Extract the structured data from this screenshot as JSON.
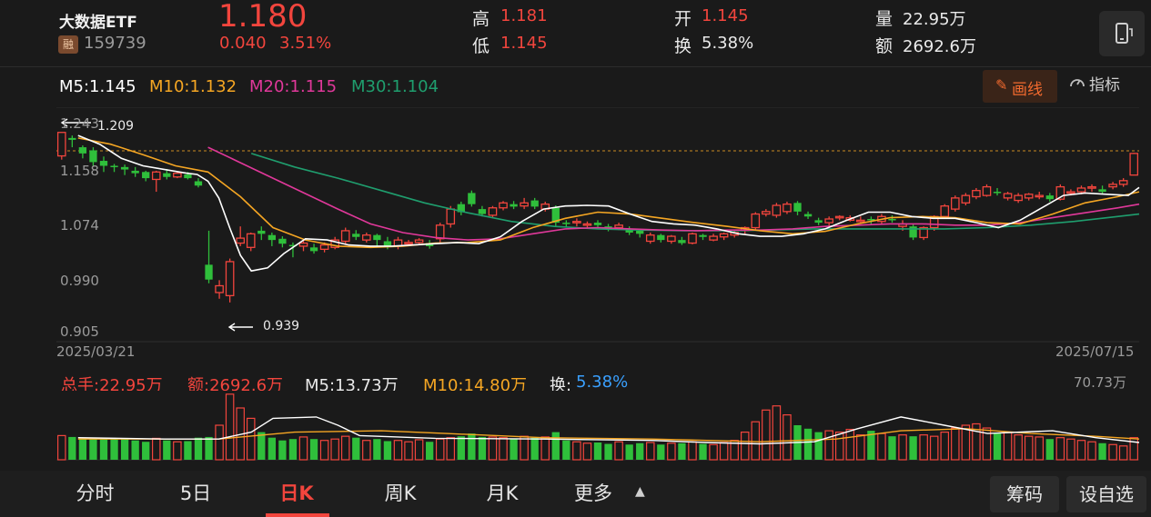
{
  "header": {
    "name": "大数据ETF",
    "badge": "融",
    "code": "159739",
    "price": "1.180",
    "change": "0.040",
    "change_pct": "3.51%",
    "high_label": "高",
    "high_value": "1.181",
    "low_label": "低",
    "low_value": "1.145",
    "open_label": "开",
    "open_value": "1.145",
    "turnover_label": "换",
    "turnover_value": "5.38%",
    "volume_label": "量",
    "volume_value": "22.95万",
    "amount_label": "额",
    "amount_value": "2692.6万"
  },
  "ma_legend": {
    "m5": "M5:1.145",
    "m10": "M10:1.132",
    "m20": "M20:1.115",
    "m30": "M30:1.104"
  },
  "tools": {
    "draw_label": "画线",
    "indicator_label": "指标"
  },
  "colors": {
    "up": "#f2453d",
    "down": "#2fbf3b",
    "m5": "#ffffff",
    "m10": "#f5a623",
    "m20": "#e0389a",
    "m30": "#1f9e6e"
  },
  "price_axis": {
    "ticks": [
      "1.243",
      "1.158",
      "1.074",
      "0.990",
      "0.905"
    ],
    "start_date": "2025/03/21",
    "end_date": "2025/07/15",
    "high_marker": "1.209",
    "low_marker": "0.939"
  },
  "volume_legend": {
    "total": "总手:22.95万",
    "amount": "额:2692.6万",
    "m5": "M5:13.73万",
    "m10": "M10:14.80万",
    "turnover_label": "换:",
    "turnover_value": "5.38%",
    "max": "70.73万"
  },
  "bottom_tabs": [
    "分时",
    "5日",
    "日K",
    "周K",
    "月K",
    "更多"
  ],
  "bottom_buttons": {
    "chips": "筹码",
    "self_select": "设自选"
  },
  "chart_data": {
    "type": "candlestick",
    "title": "",
    "x_start": "2025/03/21",
    "x_end": "2025/07/15",
    "ylim": [
      0.905,
      1.243
    ],
    "candles": [
      [
        1.176,
        1.214,
        1.211,
        1.17
      ],
      [
        1.205,
        1.202,
        1.209,
        1.19
      ],
      [
        1.19,
        1.18,
        1.193,
        1.172
      ],
      [
        1.185,
        1.166,
        1.19,
        1.16
      ],
      [
        1.168,
        1.16,
        1.175,
        1.15
      ],
      [
        1.16,
        1.158,
        1.163,
        1.15
      ],
      [
        1.158,
        1.154,
        1.162,
        1.145
      ],
      [
        1.152,
        1.148,
        1.158,
        1.142
      ],
      [
        1.15,
        1.14,
        1.152,
        1.135
      ],
      [
        1.138,
        1.15,
        1.152,
        1.118
      ],
      [
        1.148,
        1.142,
        1.155,
        1.138
      ],
      [
        1.142,
        1.148,
        1.15,
        1.14
      ],
      [
        1.146,
        1.14,
        1.15,
        1.138
      ],
      [
        1.135,
        1.128,
        1.14,
        1.125
      ],
      [
        1.0,
        0.976,
        1.055,
        0.97
      ],
      [
        0.955,
        0.966,
        0.975,
        0.945
      ],
      [
        0.95,
        1.005,
        1.01,
        0.939
      ],
      [
        1.035,
        1.043,
        1.062,
        1.03
      ],
      [
        1.028,
        1.05,
        1.052,
        1.022
      ],
      [
        1.055,
        1.05,
        1.062,
        1.04
      ],
      [
        1.048,
        1.04,
        1.052,
        1.03
      ],
      [
        1.042,
        1.034,
        1.046,
        1.028
      ],
      [
        1.032,
        1.03,
        1.036,
        1.012
      ],
      [
        1.03,
        1.035,
        1.04,
        1.022
      ],
      [
        1.028,
        1.022,
        1.034,
        1.018
      ],
      [
        1.025,
        1.032,
        1.036,
        1.02
      ],
      [
        1.028,
        1.04,
        1.045,
        1.025
      ],
      [
        1.038,
        1.055,
        1.06,
        1.032
      ],
      [
        1.05,
        1.045,
        1.056,
        1.04
      ],
      [
        1.04,
        1.048,
        1.052,
        1.036
      ],
      [
        1.048,
        1.04,
        1.05,
        1.028
      ],
      [
        1.038,
        1.03,
        1.045,
        1.025
      ],
      [
        1.03,
        1.04,
        1.045,
        1.025
      ],
      [
        1.034,
        1.036,
        1.04,
        1.03
      ],
      [
        1.036,
        1.04,
        1.043,
        1.032
      ],
      [
        1.035,
        1.03,
        1.04,
        1.026
      ],
      [
        1.042,
        1.064,
        1.068,
        1.036
      ],
      [
        1.066,
        1.09,
        1.095,
        1.06
      ],
      [
        1.098,
        1.085,
        1.102,
        1.08
      ],
      [
        1.116,
        1.098,
        1.12,
        1.094
      ],
      [
        1.09,
        1.082,
        1.095,
        1.078
      ],
      [
        1.08,
        1.092,
        1.095,
        1.075
      ],
      [
        1.092,
        1.1,
        1.103,
        1.088
      ],
      [
        1.098,
        1.094,
        1.103,
        1.09
      ],
      [
        1.095,
        1.1,
        1.108,
        1.09
      ],
      [
        1.104,
        1.094,
        1.108,
        1.09
      ],
      [
        1.09,
        1.098,
        1.102,
        1.086
      ],
      [
        1.092,
        1.068,
        1.096,
        1.062
      ],
      [
        1.068,
        1.066,
        1.072,
        1.06
      ],
      [
        1.068,
        1.07,
        1.075,
        1.062
      ],
      [
        1.066,
        1.066,
        1.07,
        1.058
      ],
      [
        1.068,
        1.064,
        1.072,
        1.06
      ],
      [
        1.062,
        1.06,
        1.066,
        1.054
      ],
      [
        1.06,
        1.064,
        1.068,
        1.056
      ],
      [
        1.058,
        1.052,
        1.062,
        1.048
      ],
      [
        1.055,
        1.05,
        1.058,
        1.044
      ],
      [
        1.038,
        1.048,
        1.052,
        1.034
      ],
      [
        1.048,
        1.04,
        1.05,
        1.036
      ],
      [
        1.038,
        1.046,
        1.048,
        1.034
      ],
      [
        1.04,
        1.035,
        1.045,
        1.032
      ],
      [
        1.035,
        1.05,
        1.052,
        1.033
      ],
      [
        1.048,
        1.045,
        1.05,
        1.04
      ],
      [
        1.04,
        1.046,
        1.05,
        1.038
      ],
      [
        1.045,
        1.05,
        1.052,
        1.04
      ],
      [
        1.048,
        1.052,
        1.056,
        1.044
      ],
      [
        1.055,
        1.06,
        1.062,
        1.05
      ],
      [
        1.06,
        1.082,
        1.085,
        1.055
      ],
      [
        1.082,
        1.086,
        1.09,
        1.078
      ],
      [
        1.08,
        1.096,
        1.1,
        1.076
      ],
      [
        1.086,
        1.098,
        1.102,
        1.082
      ],
      [
        1.1,
        1.086,
        1.103,
        1.08
      ],
      [
        1.082,
        1.078,
        1.086,
        1.074
      ],
      [
        1.072,
        1.068,
        1.076,
        1.064
      ],
      [
        1.068,
        1.074,
        1.078,
        1.062
      ],
      [
        1.076,
        1.078,
        1.08,
        1.072
      ],
      [
        1.072,
        1.076,
        1.08,
        1.07
      ],
      [
        1.072,
        1.072,
        1.078,
        1.068
      ],
      [
        1.074,
        1.072,
        1.078,
        1.066
      ],
      [
        1.07,
        1.078,
        1.082,
        1.066
      ],
      [
        1.074,
        1.072,
        1.08,
        1.068
      ],
      [
        1.062,
        1.066,
        1.072,
        1.055
      ],
      [
        1.062,
        1.044,
        1.066,
        1.04
      ],
      [
        1.044,
        1.06,
        1.062,
        1.04
      ],
      [
        1.06,
        1.078,
        1.08,
        1.055
      ],
      [
        1.078,
        1.095,
        1.098,
        1.074
      ],
      [
        1.09,
        1.108,
        1.112,
        1.086
      ],
      [
        1.1,
        1.112,
        1.116,
        1.096
      ],
      [
        1.11,
        1.12,
        1.124,
        1.106
      ],
      [
        1.112,
        1.126,
        1.13,
        1.11
      ],
      [
        1.118,
        1.116,
        1.124,
        1.112
      ],
      [
        1.108,
        1.115,
        1.118,
        1.104
      ],
      [
        1.104,
        1.112,
        1.116,
        1.1
      ],
      [
        1.108,
        1.114,
        1.116,
        1.104
      ],
      [
        1.11,
        1.112,
        1.118,
        1.106
      ],
      [
        1.112,
        1.106,
        1.116,
        1.102
      ],
      [
        1.106,
        1.126,
        1.13,
        1.104
      ],
      [
        1.116,
        1.118,
        1.122,
        1.112
      ],
      [
        1.118,
        1.124,
        1.128,
        1.114
      ],
      [
        1.124,
        1.126,
        1.13,
        1.118
      ],
      [
        1.122,
        1.118,
        1.128,
        1.114
      ],
      [
        1.126,
        1.13,
        1.134,
        1.122
      ],
      [
        1.13,
        1.136,
        1.14,
        1.126
      ],
      [
        1.145,
        1.18,
        1.181,
        1.145
      ]
    ],
    "ma5": [
      [
        0.02,
        1.209
      ],
      [
        0.04,
        1.195
      ],
      [
        0.06,
        1.172
      ],
      [
        0.08,
        1.16
      ],
      [
        0.1,
        1.154
      ],
      [
        0.12,
        1.148
      ],
      [
        0.13,
        1.146
      ],
      [
        0.14,
        1.135
      ],
      [
        0.15,
        1.108
      ],
      [
        0.16,
        1.06
      ],
      [
        0.17,
        1.015
      ],
      [
        0.18,
        0.99
      ],
      [
        0.195,
        0.995
      ],
      [
        0.21,
        1.018
      ],
      [
        0.23,
        1.042
      ],
      [
        0.25,
        1.04
      ],
      [
        0.27,
        1.032
      ],
      [
        0.29,
        1.03
      ],
      [
        0.31,
        1.03
      ],
      [
        0.33,
        1.032
      ],
      [
        0.35,
        1.034
      ],
      [
        0.37,
        1.036
      ],
      [
        0.39,
        1.034
      ],
      [
        0.41,
        1.045
      ],
      [
        0.43,
        1.07
      ],
      [
        0.45,
        1.09
      ],
      [
        0.47,
        1.095
      ],
      [
        0.49,
        1.096
      ],
      [
        0.51,
        1.095
      ],
      [
        0.53,
        1.082
      ],
      [
        0.55,
        1.07
      ],
      [
        0.57,
        1.066
      ],
      [
        0.59,
        1.064
      ],
      [
        0.61,
        1.058
      ],
      [
        0.63,
        1.05
      ],
      [
        0.65,
        1.046
      ],
      [
        0.67,
        1.046
      ],
      [
        0.69,
        1.05
      ],
      [
        0.71,
        1.058
      ],
      [
        0.73,
        1.072
      ],
      [
        0.75,
        1.085
      ],
      [
        0.77,
        1.085
      ],
      [
        0.79,
        1.078
      ],
      [
        0.81,
        1.075
      ],
      [
        0.83,
        1.075
      ],
      [
        0.85,
        1.068
      ],
      [
        0.87,
        1.06
      ],
      [
        0.89,
        1.072
      ],
      [
        0.91,
        1.092
      ],
      [
        0.93,
        1.112
      ],
      [
        0.95,
        1.116
      ],
      [
        0.97,
        1.114
      ],
      [
        0.99,
        1.112
      ],
      [
        1.0,
        1.125
      ]
    ],
    "ma10": [
      [
        0.02,
        1.205
      ],
      [
        0.05,
        1.195
      ],
      [
        0.08,
        1.178
      ],
      [
        0.11,
        1.16
      ],
      [
        0.14,
        1.15
      ],
      [
        0.17,
        1.11
      ],
      [
        0.2,
        1.06
      ],
      [
        0.23,
        1.04
      ],
      [
        0.26,
        1.03
      ],
      [
        0.29,
        1.028
      ],
      [
        0.32,
        1.03
      ],
      [
        0.35,
        1.035
      ],
      [
        0.38,
        1.036
      ],
      [
        0.41,
        1.04
      ],
      [
        0.44,
        1.06
      ],
      [
        0.47,
        1.075
      ],
      [
        0.5,
        1.085
      ],
      [
        0.53,
        1.082
      ],
      [
        0.56,
        1.075
      ],
      [
        0.59,
        1.068
      ],
      [
        0.62,
        1.062
      ],
      [
        0.65,
        1.055
      ],
      [
        0.68,
        1.05
      ],
      [
        0.71,
        1.054
      ],
      [
        0.74,
        1.066
      ],
      [
        0.77,
        1.076
      ],
      [
        0.8,
        1.078
      ],
      [
        0.83,
        1.076
      ],
      [
        0.86,
        1.068
      ],
      [
        0.89,
        1.066
      ],
      [
        0.92,
        1.082
      ],
      [
        0.95,
        1.1
      ],
      [
        0.98,
        1.11
      ],
      [
        1.0,
        1.118
      ]
    ],
    "ma20": [
      [
        0.14,
        1.19
      ],
      [
        0.17,
        1.165
      ],
      [
        0.2,
        1.14
      ],
      [
        0.23,
        1.115
      ],
      [
        0.26,
        1.09
      ],
      [
        0.29,
        1.066
      ],
      [
        0.32,
        1.052
      ],
      [
        0.35,
        1.044
      ],
      [
        0.38,
        1.04
      ],
      [
        0.41,
        1.042
      ],
      [
        0.44,
        1.05
      ],
      [
        0.47,
        1.058
      ],
      [
        0.5,
        1.06
      ],
      [
        0.53,
        1.058
      ],
      [
        0.56,
        1.056
      ],
      [
        0.59,
        1.055
      ],
      [
        0.62,
        1.056
      ],
      [
        0.65,
        1.056
      ],
      [
        0.68,
        1.058
      ],
      [
        0.71,
        1.062
      ],
      [
        0.74,
        1.064
      ],
      [
        0.77,
        1.066
      ],
      [
        0.8,
        1.066
      ],
      [
        0.83,
        1.064
      ],
      [
        0.86,
        1.064
      ],
      [
        0.89,
        1.068
      ],
      [
        0.92,
        1.076
      ],
      [
        0.95,
        1.084
      ],
      [
        0.98,
        1.092
      ],
      [
        1.0,
        1.098
      ]
    ],
    "ma30": [
      [
        0.18,
        1.18
      ],
      [
        0.22,
        1.158
      ],
      [
        0.26,
        1.14
      ],
      [
        0.3,
        1.12
      ],
      [
        0.34,
        1.1
      ],
      [
        0.38,
        1.084
      ],
      [
        0.42,
        1.07
      ],
      [
        0.46,
        1.062
      ],
      [
        0.5,
        1.058
      ],
      [
        0.54,
        1.056
      ],
      [
        0.58,
        1.055
      ],
      [
        0.62,
        1.055
      ],
      [
        0.66,
        1.056
      ],
      [
        0.7,
        1.058
      ],
      [
        0.74,
        1.058
      ],
      [
        0.78,
        1.058
      ],
      [
        0.82,
        1.058
      ],
      [
        0.86,
        1.06
      ],
      [
        0.9,
        1.064
      ],
      [
        0.94,
        1.07
      ],
      [
        0.98,
        1.078
      ],
      [
        1.0,
        1.082
      ]
    ],
    "volume": [
      0.35,
      0.33,
      0.32,
      0.31,
      0.3,
      0.3,
      0.31,
      0.28,
      0.26,
      0.31,
      0.28,
      0.26,
      0.27,
      0.32,
      0.33,
      0.5,
      0.95,
      0.75,
      0.6,
      0.4,
      0.32,
      0.28,
      0.3,
      0.33,
      0.3,
      0.28,
      0.3,
      0.34,
      0.32,
      0.28,
      0.3,
      0.27,
      0.28,
      0.26,
      0.29,
      0.26,
      0.3,
      0.32,
      0.34,
      0.38,
      0.33,
      0.33,
      0.32,
      0.3,
      0.34,
      0.32,
      0.33,
      0.4,
      0.28,
      0.26,
      0.24,
      0.25,
      0.23,
      0.26,
      0.22,
      0.24,
      0.25,
      0.22,
      0.24,
      0.24,
      0.26,
      0.23,
      0.22,
      0.25,
      0.28,
      0.4,
      0.55,
      0.72,
      0.78,
      0.65,
      0.5,
      0.45,
      0.4,
      0.42,
      0.4,
      0.44,
      0.36,
      0.42,
      0.38,
      0.34,
      0.36,
      0.34,
      0.36,
      0.34,
      0.4,
      0.46,
      0.5,
      0.52,
      0.46,
      0.38,
      0.4,
      0.36,
      0.34,
      0.33,
      0.3,
      0.32,
      0.3,
      0.28,
      0.26,
      0.24,
      0.22,
      0.2,
      0.32
    ],
    "volume_ma5": [
      [
        0.02,
        0.32
      ],
      [
        0.1,
        0.3
      ],
      [
        0.15,
        0.3
      ],
      [
        0.18,
        0.4
      ],
      [
        0.2,
        0.6
      ],
      [
        0.24,
        0.62
      ],
      [
        0.26,
        0.5
      ],
      [
        0.28,
        0.35
      ],
      [
        0.35,
        0.31
      ],
      [
        0.45,
        0.3
      ],
      [
        0.55,
        0.28
      ],
      [
        0.6,
        0.25
      ],
      [
        0.65,
        0.23
      ],
      [
        0.7,
        0.26
      ],
      [
        0.74,
        0.45
      ],
      [
        0.78,
        0.62
      ],
      [
        0.82,
        0.5
      ],
      [
        0.86,
        0.38
      ],
      [
        0.92,
        0.42
      ],
      [
        0.96,
        0.32
      ],
      [
        1.0,
        0.25
      ]
    ],
    "volume_ma10": [
      [
        0.02,
        0.3
      ],
      [
        0.15,
        0.3
      ],
      [
        0.22,
        0.4
      ],
      [
        0.3,
        0.42
      ],
      [
        0.36,
        0.38
      ],
      [
        0.45,
        0.32
      ],
      [
        0.55,
        0.3
      ],
      [
        0.65,
        0.26
      ],
      [
        0.72,
        0.3
      ],
      [
        0.78,
        0.42
      ],
      [
        0.84,
        0.45
      ],
      [
        0.9,
        0.38
      ],
      [
        0.96,
        0.34
      ],
      [
        1.0,
        0.3
      ]
    ]
  }
}
